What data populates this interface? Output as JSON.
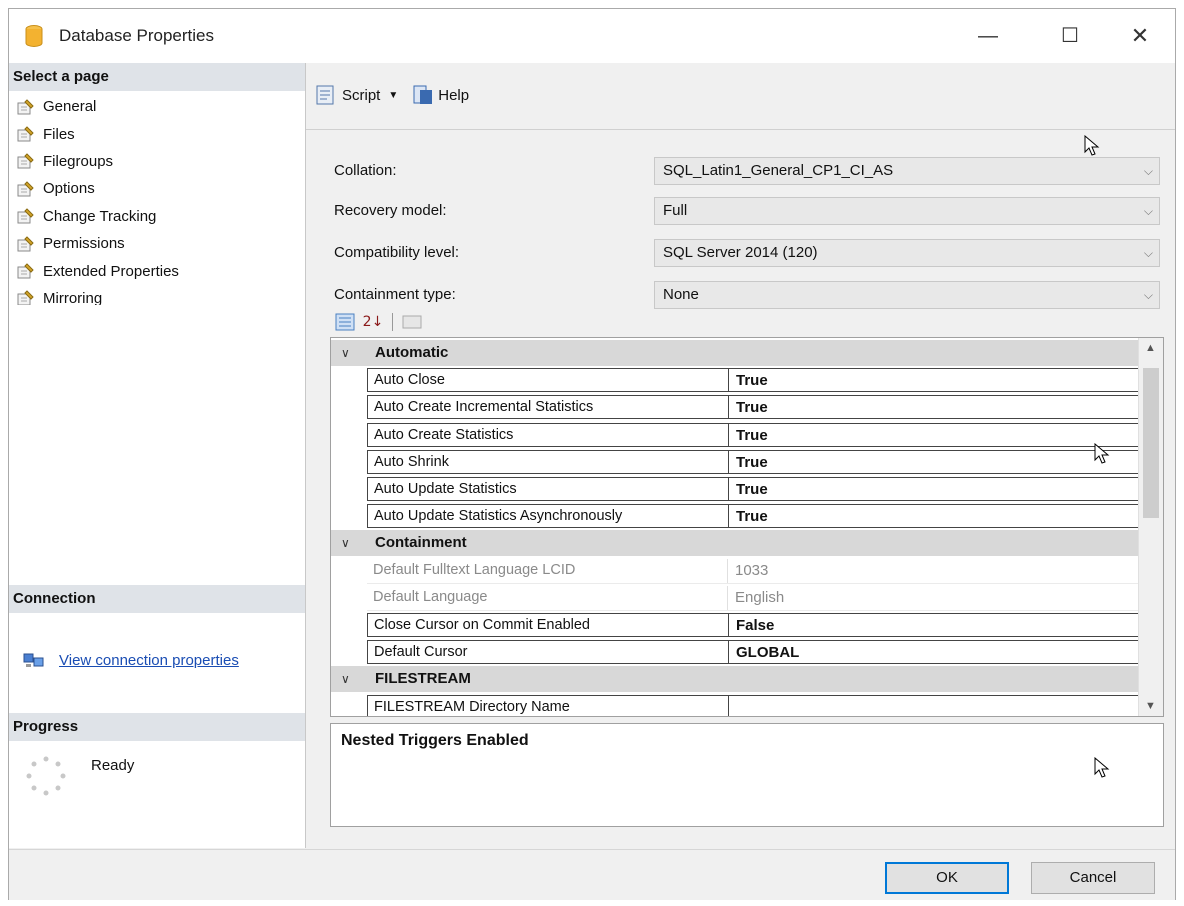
{
  "window": {
    "title": "Database Properties",
    "minimize_glyph": "—",
    "maximize_glyph": "☐",
    "close_glyph": "✕"
  },
  "left": {
    "select_page_header": "Select a page",
    "pages": [
      {
        "label": "General",
        "icon": "wrench-page-icon"
      },
      {
        "label": "Files",
        "icon": "wrench-page-icon"
      },
      {
        "label": "Filegroups",
        "icon": "wrench-page-icon"
      },
      {
        "label": "Options",
        "icon": "wrench-page-icon"
      },
      {
        "label": "Change Tracking",
        "icon": "wrench-page-icon"
      },
      {
        "label": "Permissions",
        "icon": "wrench-page-icon"
      },
      {
        "label": "Extended Properties",
        "icon": "wrench-page-icon"
      },
      {
        "label": "Mirroring",
        "icon": "wrench-page-icon"
      }
    ],
    "connection_header": "Connection",
    "connection_link": "View connection properties",
    "progress_header": "Progress",
    "progress_status": "Ready"
  },
  "toolbar": {
    "script_label": "Script",
    "help_label": "Help"
  },
  "form": {
    "collation_label": "Collation:",
    "collation_value": "SQL_Latin1_General_CP1_CI_AS",
    "recovery_label": "Recovery model:",
    "recovery_value": "Full",
    "compat_label": "Compatibility level:",
    "compat_value": "SQL Server 2014 (120)",
    "containment_label": "Containment type:",
    "containment_value": "None"
  },
  "grid_toolbar": {
    "sort_icon_text": "2↓"
  },
  "grid": {
    "categories": [
      {
        "label": "Automatic",
        "rows": [
          {
            "name": "Auto Close",
            "value": "True"
          },
          {
            "name": "Auto Create Incremental Statistics",
            "value": "True"
          },
          {
            "name": "Auto Create Statistics",
            "value": "True"
          },
          {
            "name": "Auto Shrink",
            "value": "True"
          },
          {
            "name": "Auto Update Statistics",
            "value": "True"
          },
          {
            "name": "Auto Update Statistics Asynchronously",
            "value": "True"
          }
        ]
      },
      {
        "label": "Containment",
        "rows": [
          {
            "name": "Default Fulltext Language LCID",
            "value": "1033"
          },
          {
            "name": "Default Language",
            "value": "English"
          },
          {
            "name": "Close Cursor on Commit Enabled",
            "value": "False"
          },
          {
            "name": "Default Cursor",
            "value": "GLOBAL"
          }
        ]
      },
      {
        "label": "FILESTREAM",
        "rows": [
          {
            "name": "FILESTREAM Directory Name",
            "value": ""
          }
        ]
      }
    ]
  },
  "description": {
    "title": "Nested Triggers Enabled"
  },
  "buttons": {
    "ok": "OK",
    "cancel": "Cancel"
  }
}
